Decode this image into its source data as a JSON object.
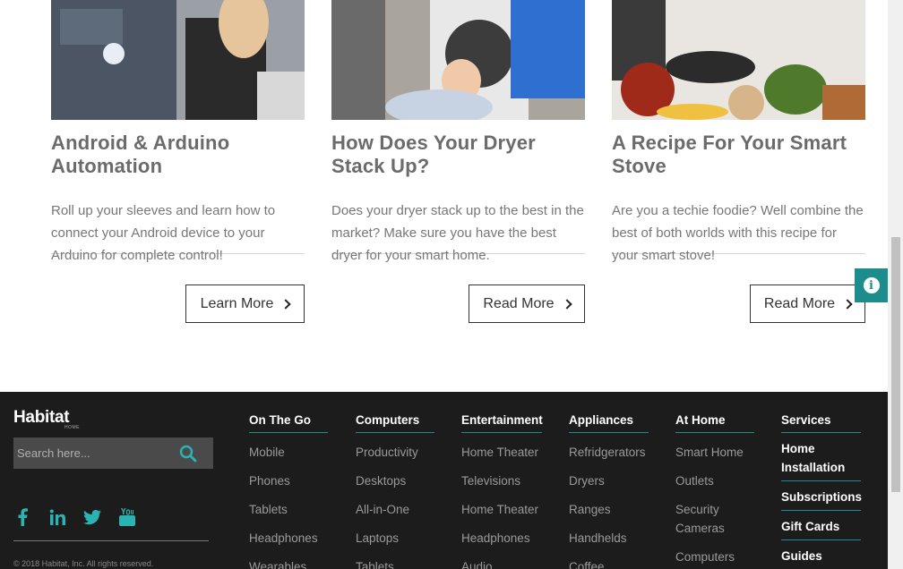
{
  "cards": [
    {
      "title": "Android & Arduino Automation",
      "text": "Roll up your sleeves and learn how to connect your Android device to your Arduino for complete control!",
      "button": "Learn More"
    },
    {
      "title": "How Does Your Dryer Stack Up?",
      "text": "Does your dryer stack up to the best in the market? Make sure you have the best dryer for your smart home.",
      "button": "Read More"
    },
    {
      "title": "A Recipe For Your Smart Stove",
      "text": "Are you a techie foodie? Well combine the best of both worlds with this recipe for your smart stove!",
      "button": "Read More"
    }
  ],
  "footer": {
    "logo": "Habitat",
    "logo_sub": "HOME",
    "search_placeholder": "Search here...",
    "copyright": "© 2018 Habitat, Inc. All rights reserved.",
    "socials": [
      "facebook-icon",
      "linkedin-icon",
      "twitter-icon",
      "youtube-icon"
    ],
    "columns": [
      {
        "heading": "On The Go",
        "items": [
          "Mobile",
          "Phones",
          "Tablets",
          "Headphones",
          "Wearables"
        ]
      },
      {
        "heading": "Computers",
        "items": [
          "Productivity",
          "Desktops",
          "All-in-One",
          "Laptops",
          "Tablets"
        ]
      },
      {
        "heading": "Entertainment",
        "items": [
          "Home Theater",
          "Televisions",
          "Home Theater",
          "Headphones",
          "Audio"
        ]
      },
      {
        "heading": "Appliances",
        "items": [
          "Refridgerators",
          "Dryers",
          "Ranges",
          "Handhelds",
          "Coffee"
        ]
      },
      {
        "heading": "At Home",
        "items": [
          "Smart Home",
          "Outlets",
          "Security Cameras",
          "Computers"
        ]
      },
      {
        "heading": "Services",
        "items": [
          "Home Installation",
          "Subscriptions",
          "Gift Cards",
          "Guides"
        ]
      }
    ]
  },
  "colors": {
    "accent": "#1d8c8c",
    "footer_bg": "#1c1c1c"
  }
}
